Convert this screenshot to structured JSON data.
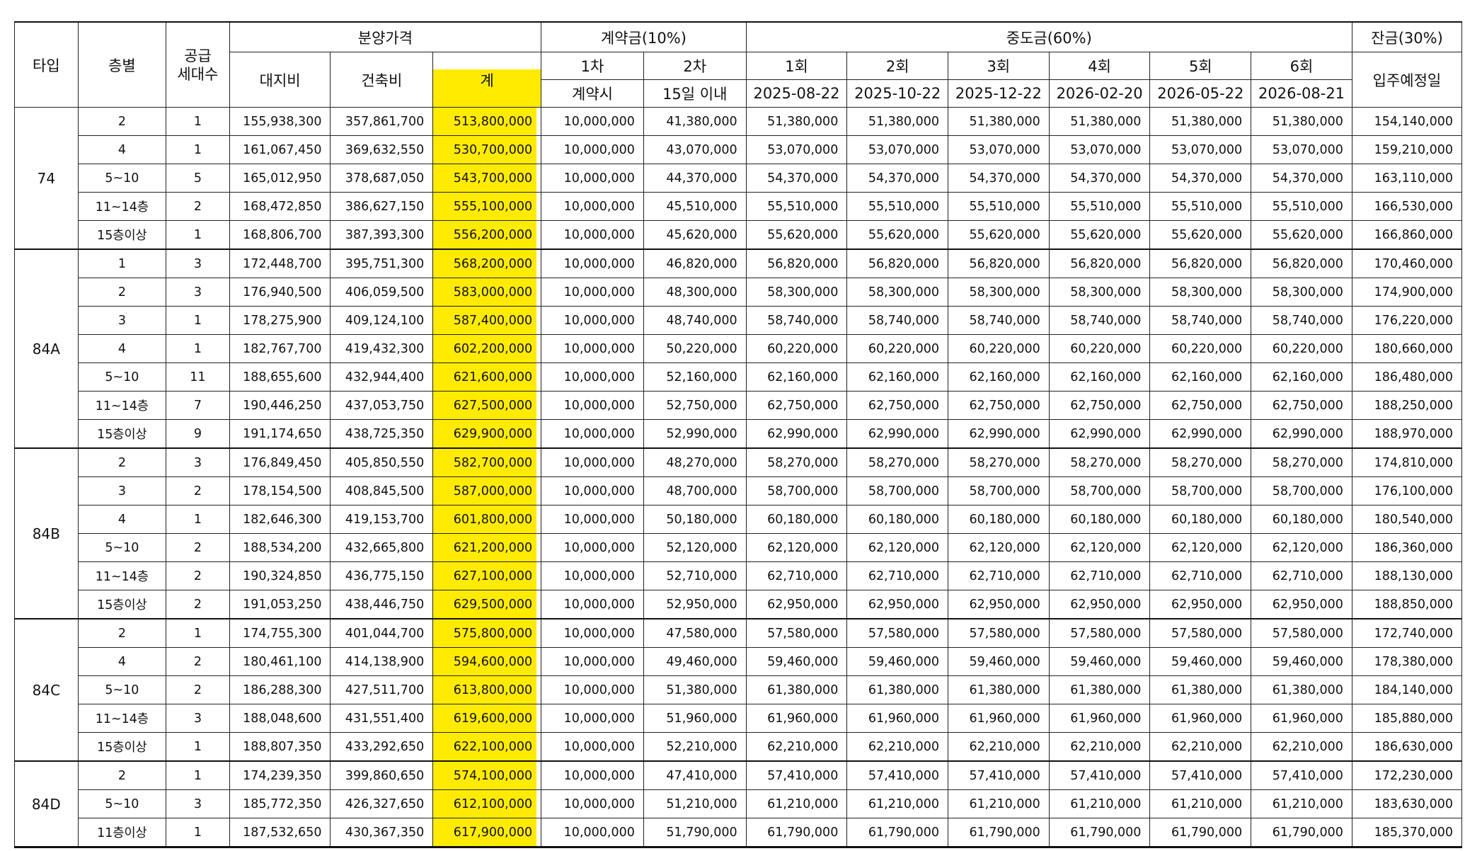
{
  "header": {
    "type": "타입",
    "floor": "층별",
    "supply_units": "공급\n세대수",
    "sale_price": "분양가격",
    "land_cost": "대지비",
    "build_cost": "건축비",
    "total": "계",
    "deposit": "계약금(10%)",
    "dep_1": "1차",
    "dep_2": "2차",
    "dep_1_when": "계약시",
    "dep_2_when": "15일 이내",
    "middle": "중도금(60%)",
    "mid_rounds": [
      "1회",
      "2회",
      "3회",
      "4회",
      "5회",
      "6회"
    ],
    "mid_dates": [
      "2025-08-22",
      "2025-10-22",
      "2025-12-22",
      "2026-02-20",
      "2026-05-22",
      "2026-08-21"
    ],
    "balance": "잔금(30%)",
    "balance_when": "입주예정일"
  },
  "highlight_color": "#ffeb00",
  "groups": [
    {
      "type": "74",
      "rows": [
        [
          "2",
          "1",
          "155,938,300",
          "357,861,700",
          "513,800,000",
          "10,000,000",
          "41,380,000",
          "51,380,000",
          "154,140,000"
        ],
        [
          "4",
          "1",
          "161,067,450",
          "369,632,550",
          "530,700,000",
          "10,000,000",
          "43,070,000",
          "53,070,000",
          "159,210,000"
        ],
        [
          "5~10",
          "5",
          "165,012,950",
          "378,687,050",
          "543,700,000",
          "10,000,000",
          "44,370,000",
          "54,370,000",
          "163,110,000"
        ],
        [
          "11~14층",
          "2",
          "168,472,850",
          "386,627,150",
          "555,100,000",
          "10,000,000",
          "45,510,000",
          "55,510,000",
          "166,530,000"
        ],
        [
          "15층이상",
          "1",
          "168,806,700",
          "387,393,300",
          "556,200,000",
          "10,000,000",
          "45,620,000",
          "55,620,000",
          "166,860,000"
        ]
      ]
    },
    {
      "type": "84A",
      "rows": [
        [
          "1",
          "3",
          "172,448,700",
          "395,751,300",
          "568,200,000",
          "10,000,000",
          "46,820,000",
          "56,820,000",
          "170,460,000"
        ],
        [
          "2",
          "3",
          "176,940,500",
          "406,059,500",
          "583,000,000",
          "10,000,000",
          "48,300,000",
          "58,300,000",
          "174,900,000"
        ],
        [
          "3",
          "1",
          "178,275,900",
          "409,124,100",
          "587,400,000",
          "10,000,000",
          "48,740,000",
          "58,740,000",
          "176,220,000"
        ],
        [
          "4",
          "1",
          "182,767,700",
          "419,432,300",
          "602,200,000",
          "10,000,000",
          "50,220,000",
          "60,220,000",
          "180,660,000"
        ],
        [
          "5~10",
          "11",
          "188,655,600",
          "432,944,400",
          "621,600,000",
          "10,000,000",
          "52,160,000",
          "62,160,000",
          "186,480,000"
        ],
        [
          "11~14층",
          "7",
          "190,446,250",
          "437,053,750",
          "627,500,000",
          "10,000,000",
          "52,750,000",
          "62,750,000",
          "188,250,000"
        ],
        [
          "15층이상",
          "9",
          "191,174,650",
          "438,725,350",
          "629,900,000",
          "10,000,000",
          "52,990,000",
          "62,990,000",
          "188,970,000"
        ]
      ]
    },
    {
      "type": "84B",
      "rows": [
        [
          "2",
          "3",
          "176,849,450",
          "405,850,550",
          "582,700,000",
          "10,000,000",
          "48,270,000",
          "58,270,000",
          "174,810,000"
        ],
        [
          "3",
          "2",
          "178,154,500",
          "408,845,500",
          "587,000,000",
          "10,000,000",
          "48,700,000",
          "58,700,000",
          "176,100,000"
        ],
        [
          "4",
          "1",
          "182,646,300",
          "419,153,700",
          "601,800,000",
          "10,000,000",
          "50,180,000",
          "60,180,000",
          "180,540,000"
        ],
        [
          "5~10",
          "2",
          "188,534,200",
          "432,665,800",
          "621,200,000",
          "10,000,000",
          "52,120,000",
          "62,120,000",
          "186,360,000"
        ],
        [
          "11~14층",
          "2",
          "190,324,850",
          "436,775,150",
          "627,100,000",
          "10,000,000",
          "52,710,000",
          "62,710,000",
          "188,130,000"
        ],
        [
          "15층이상",
          "2",
          "191,053,250",
          "438,446,750",
          "629,500,000",
          "10,000,000",
          "52,950,000",
          "62,950,000",
          "188,850,000"
        ]
      ]
    },
    {
      "type": "84C",
      "rows": [
        [
          "2",
          "1",
          "174,755,300",
          "401,044,700",
          "575,800,000",
          "10,000,000",
          "47,580,000",
          "57,580,000",
          "172,740,000"
        ],
        [
          "4",
          "2",
          "180,461,100",
          "414,138,900",
          "594,600,000",
          "10,000,000",
          "49,460,000",
          "59,460,000",
          "178,380,000"
        ],
        [
          "5~10",
          "2",
          "186,288,300",
          "427,511,700",
          "613,800,000",
          "10,000,000",
          "51,380,000",
          "61,380,000",
          "184,140,000"
        ],
        [
          "11~14층",
          "3",
          "188,048,600",
          "431,551,400",
          "619,600,000",
          "10,000,000",
          "51,960,000",
          "61,960,000",
          "185,880,000"
        ],
        [
          "15층이상",
          "1",
          "188,807,350",
          "433,292,650",
          "622,100,000",
          "10,000,000",
          "52,210,000",
          "62,210,000",
          "186,630,000"
        ]
      ]
    },
    {
      "type": "84D",
      "rows": [
        [
          "2",
          "1",
          "174,239,350",
          "399,860,650",
          "574,100,000",
          "10,000,000",
          "47,410,000",
          "57,410,000",
          "172,230,000"
        ],
        [
          "5~10",
          "3",
          "185,772,350",
          "426,327,650",
          "612,100,000",
          "10,000,000",
          "51,210,000",
          "61,210,000",
          "183,630,000"
        ],
        [
          "11층이상",
          "1",
          "187,532,650",
          "430,367,350",
          "617,900,000",
          "10,000,000",
          "51,790,000",
          "61,790,000",
          "185,370,000"
        ]
      ]
    }
  ]
}
